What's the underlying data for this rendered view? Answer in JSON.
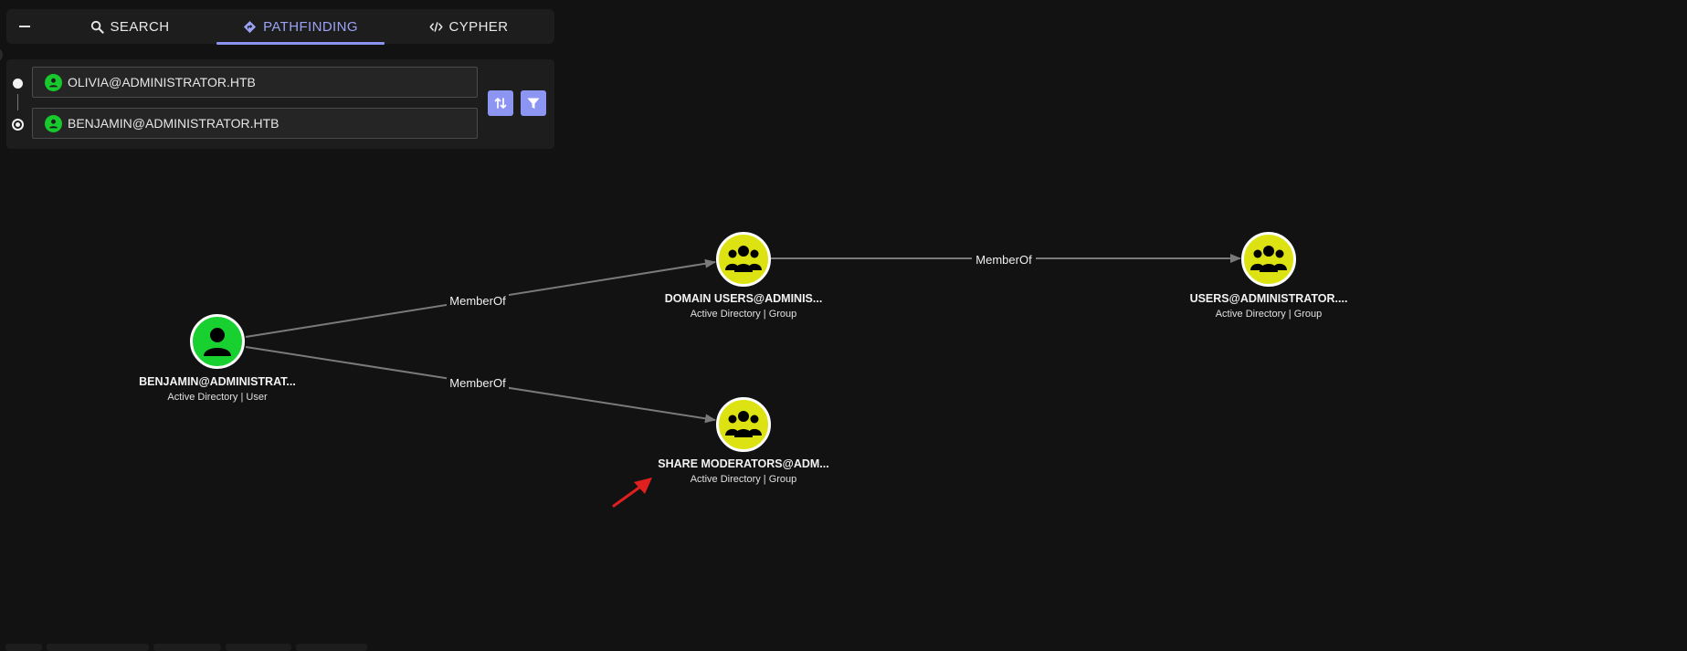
{
  "tabs": {
    "search_label": "SEARCH",
    "pathfinding_label": "PATHFINDING",
    "cypher_label": "CYPHER",
    "active": "pathfinding"
  },
  "pathfinding": {
    "start_value": "OLIVIA@ADMINISTRATOR.HTB",
    "end_value": "BENJAMIN@ADMINISTRATOR.HTB"
  },
  "graph": {
    "nodes": {
      "benjamin": {
        "title": "BENJAMIN@ADMINISTRAT...",
        "subtitle": "Active Directory | User",
        "icon": "user-icon"
      },
      "domain_users": {
        "title": "DOMAIN USERS@ADMINIS...",
        "subtitle": "Active Directory | Group",
        "icon": "group-icon"
      },
      "users": {
        "title": "USERS@ADMINISTRATOR....",
        "subtitle": "Active Directory | Group",
        "icon": "group-icon"
      },
      "share_moderators": {
        "title": "SHARE MODERATORS@ADM...",
        "subtitle": "Active Directory | Group",
        "icon": "group-icon"
      }
    },
    "edges": {
      "benjamin_domain_users": "MemberOf",
      "domain_users_users": "MemberOf",
      "benjamin_share_moderators": "MemberOf"
    }
  },
  "colors": {
    "accent": "#8c95f2",
    "user_node": "#18d02f",
    "group_node": "#dde312",
    "edge": "#7a7a7a",
    "annotation_arrow": "#e0201f"
  }
}
